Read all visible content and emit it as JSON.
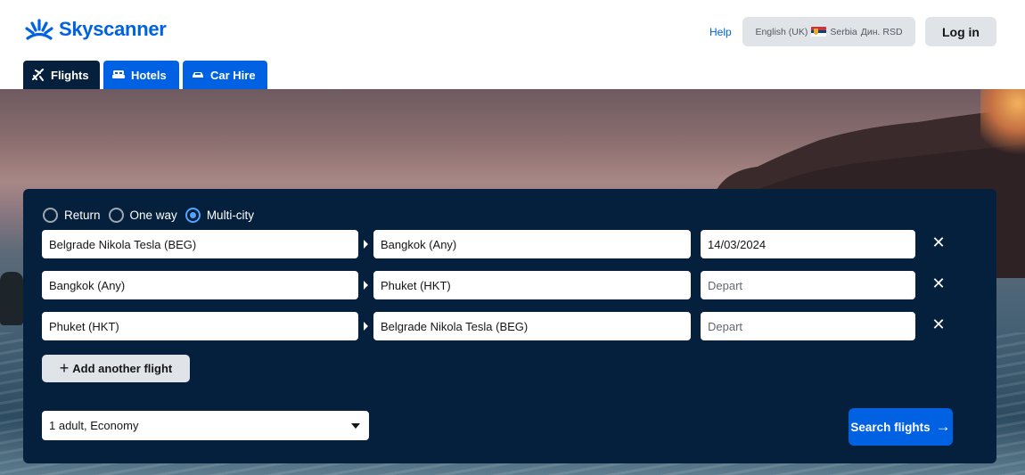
{
  "brand": {
    "name": "Skyscanner",
    "color": "#0062e3"
  },
  "header": {
    "help": "Help",
    "locale": {
      "language": "English (UK)",
      "country": "Serbia",
      "currency": "Дин. RSD"
    },
    "login": "Log in"
  },
  "tabs": [
    {
      "label": "Flights",
      "icon": "plane-icon",
      "active": true
    },
    {
      "label": "Hotels",
      "icon": "bed-icon",
      "active": false
    },
    {
      "label": "Car Hire",
      "icon": "car-icon",
      "active": false
    }
  ],
  "search": {
    "trip_types": [
      {
        "label": "Return",
        "selected": false
      },
      {
        "label": "One way",
        "selected": false
      },
      {
        "label": "Multi-city",
        "selected": true
      }
    ],
    "legs": [
      {
        "from": "Belgrade Nikola Tesla (BEG)",
        "to": "Bangkok (Any)",
        "date": "14/03/2024",
        "date_placeholder": "Depart"
      },
      {
        "from": "Bangkok (Any)",
        "to": "Phuket (HKT)",
        "date": "",
        "date_placeholder": "Depart"
      },
      {
        "from": "Phuket (HKT)",
        "to": "Belgrade Nikola Tesla (BEG)",
        "date": "",
        "date_placeholder": "Depart"
      }
    ],
    "add_flight": "Add another flight",
    "travellers": "1 adult, Economy",
    "submit": "Search flights"
  },
  "colors": {
    "panel": "#05203c",
    "accent": "#0062e3",
    "radio_on": "#54a4ff"
  }
}
